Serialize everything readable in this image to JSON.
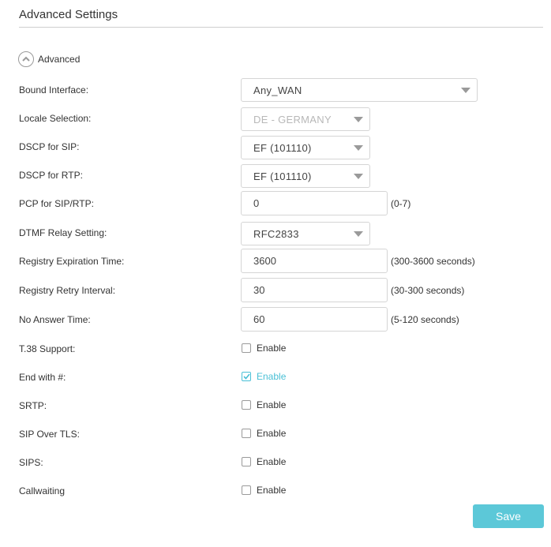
{
  "header": {
    "title": "Advanced Settings"
  },
  "advanced_toggle": {
    "label": "Advanced",
    "icon": "chevron-up-icon"
  },
  "fields": {
    "bound_interface": {
      "label": "Bound Interface:",
      "value": "Any_WAN"
    },
    "locale_selection": {
      "label": "Locale Selection:",
      "value": "DE - GERMANY",
      "disabled": true
    },
    "dscp_sip": {
      "label": "DSCP for SIP:",
      "value": "EF (101110)"
    },
    "dscp_rtp": {
      "label": "DSCP for RTP:",
      "value": "EF (101110)"
    },
    "pcp_sip_rtp": {
      "label": "PCP for SIP/RTP:",
      "value": "0",
      "hint": "(0-7)"
    },
    "dtmf_relay": {
      "label": "DTMF Relay Setting:",
      "value": "RFC2833"
    },
    "registry_expiration": {
      "label": "Registry Expiration Time:",
      "value": "3600",
      "hint": "(300-3600 seconds)"
    },
    "registry_retry": {
      "label": "Registry Retry Interval:",
      "value": "30",
      "hint": "(30-300 seconds)"
    },
    "no_answer_time": {
      "label": "No Answer Time:",
      "value": "60",
      "hint": "(5-120 seconds)"
    }
  },
  "checkboxes": {
    "t38": {
      "label": "T.38 Support:",
      "option": "Enable",
      "checked": false
    },
    "end_with_hash": {
      "label": "End with #:",
      "option": "Enable",
      "checked": true
    },
    "srtp": {
      "label": "SRTP:",
      "option": "Enable",
      "checked": false
    },
    "sip_over_tls": {
      "label": "SIP Over TLS:",
      "option": "Enable",
      "checked": false
    },
    "sips": {
      "label": "SIPS:",
      "option": "Enable",
      "checked": false
    },
    "callwaiting": {
      "label": "Callwaiting",
      "option": "Enable",
      "checked": false
    }
  },
  "actions": {
    "save_label": "Save"
  },
  "colors": {
    "accent": "#4ac0d6",
    "button": "#5cc8d8",
    "text": "#333333",
    "border": "#d5d5d5"
  }
}
